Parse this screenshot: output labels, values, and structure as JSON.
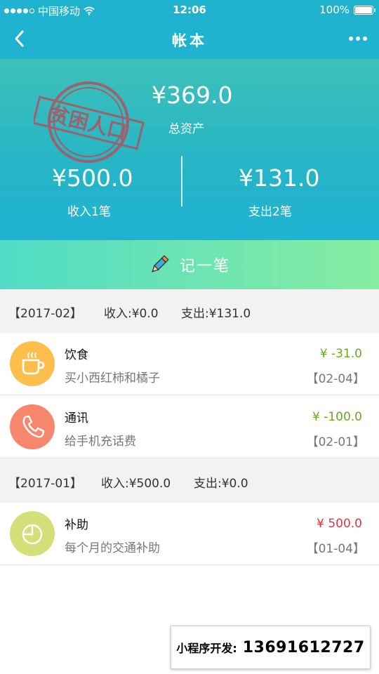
{
  "status_bar": {
    "carrier": "中国移动",
    "time": "12:06",
    "battery": "100%",
    "battery_level": 1.0
  },
  "nav": {
    "title": "帐本",
    "back_icon": "chevron-left-icon",
    "more_icon": "more-dots-icon"
  },
  "summary": {
    "stamp_text": "贫困人口",
    "total_amount": "¥369.0",
    "total_label": "总资产",
    "income_amount": "¥500.0",
    "income_label": "收入1笔",
    "expense_amount": "¥131.0",
    "expense_label": "支出2笔"
  },
  "record_button": {
    "label": "记一笔",
    "icon": "pen-icon"
  },
  "months": [
    {
      "period": "【2017-02】",
      "income": "收入:¥0.0",
      "expense": "支出:¥131.0",
      "items": [
        {
          "icon": "coffee-cup-icon",
          "icon_color": "#fcbf4b",
          "name": "饮食",
          "note": "买小西红柿和橘子",
          "amount": "¥ -31.0",
          "amount_color": "#6aaa1e",
          "date": "【02-04】"
        },
        {
          "icon": "phone-icon",
          "icon_color": "#f6866c",
          "name": "通讯",
          "note": "给手机充话费",
          "amount": "¥ -100.0",
          "amount_color": "#6aaa1e",
          "date": "【02-01】"
        }
      ]
    },
    {
      "period": "【2017-01】",
      "income": "收入:¥500.0",
      "expense": "支出:¥0.0",
      "items": [
        {
          "icon": "pie-chart-icon",
          "icon_color": "#d5df7a",
          "name": "补助",
          "note": "每个月的交通补助",
          "amount": "¥ 500.0",
          "amount_color": "#e5323f",
          "date": "【01-04】"
        }
      ]
    }
  ],
  "contact_banner": {
    "label": "小程序开发:",
    "phone": "13691612727"
  },
  "colors": {
    "primary": "#1fb3cf",
    "record_gradient_start": "#4fdcc6",
    "record_gradient_end": "#86eda0",
    "expense_green": "#6aaa1e",
    "income_red": "#e5323f"
  }
}
